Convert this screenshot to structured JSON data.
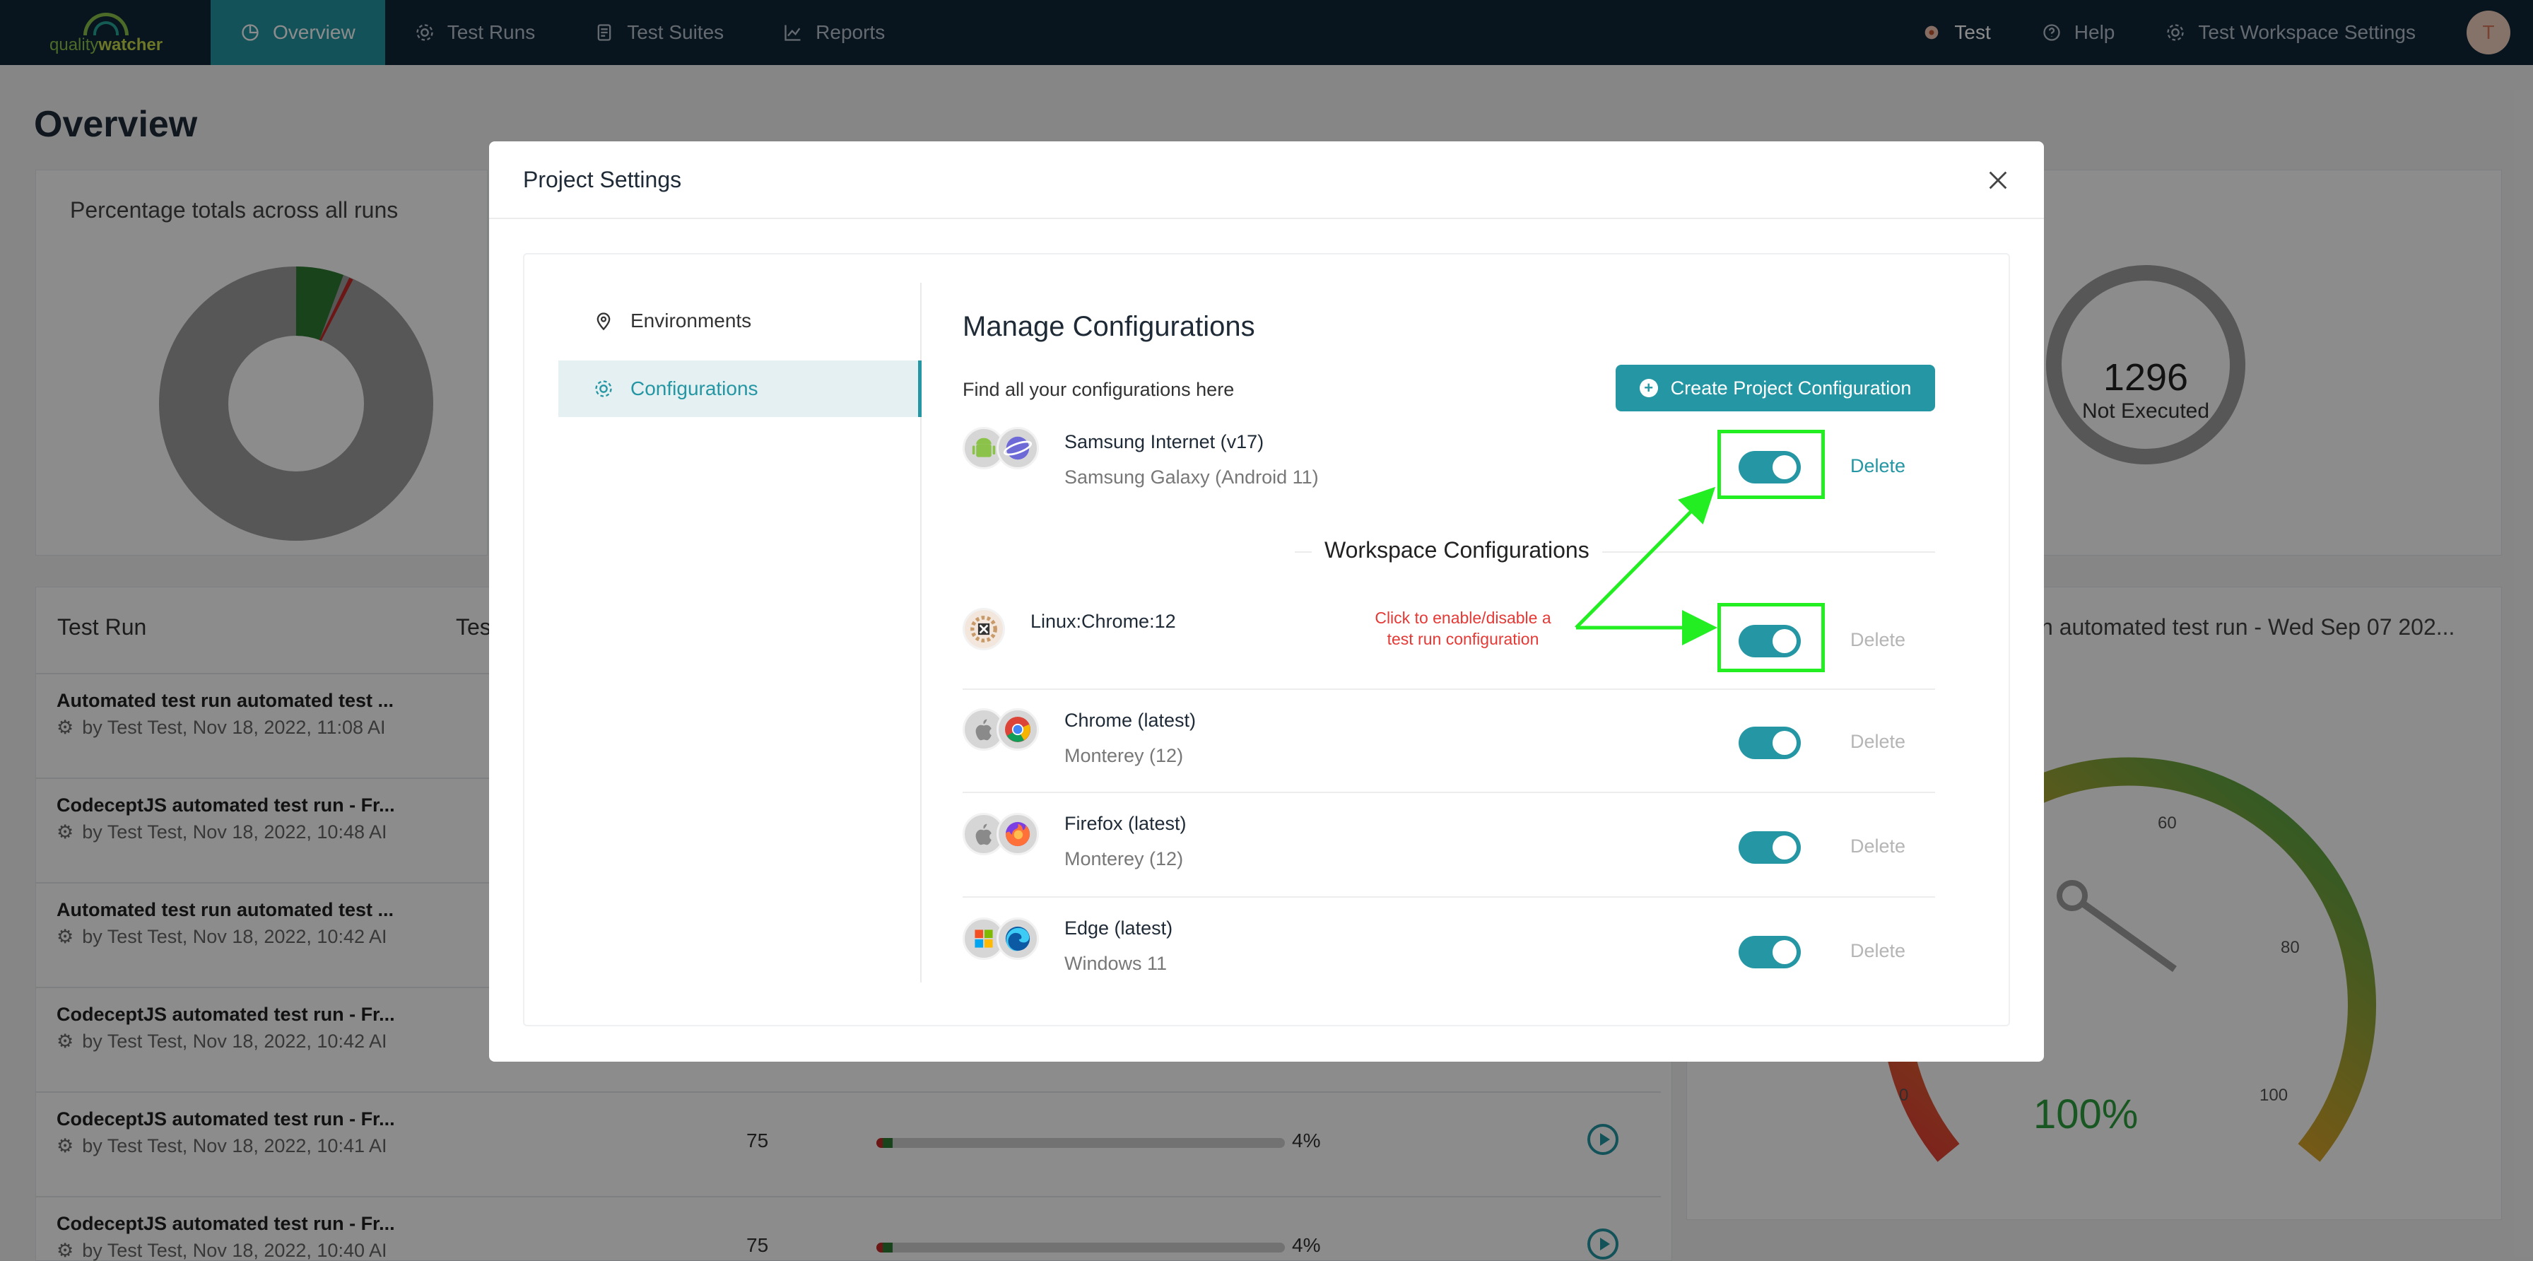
{
  "nav": {
    "logo_a": "quality",
    "logo_b": "watcher",
    "items": [
      {
        "label": "Overview",
        "active": true
      },
      {
        "label": "Test Runs"
      },
      {
        "label": "Test Suites"
      },
      {
        "label": "Reports"
      }
    ],
    "right": {
      "workspace": "Test",
      "help": "Help",
      "settings": "Test Workspace Settings",
      "avatar": "T"
    }
  },
  "page": {
    "title": "Overview",
    "card_title": "Percentage totals across all runs",
    "not_executed_count": "1296",
    "not_executed_label": "Not Executed",
    "table_col_run": "Test Run",
    "table_col_test": "Tes",
    "right_card_title": "n automated test run - Wed Sep 07 202...",
    "gauge_value": "100%",
    "gauge_ticks": [
      "0",
      "60",
      "80",
      "100"
    ],
    "runs": [
      {
        "title": "Automated test run automated test ...",
        "sub": "by Test Test, Nov 18, 2022, 11:08 AI"
      },
      {
        "title": "CodeceptJS automated test run - Fr...",
        "sub": "by Test Test, Nov 18, 2022, 10:48 AI"
      },
      {
        "title": "Automated test run automated test ...",
        "sub": "by Test Test, Nov 18, 2022, 10:42 AI"
      },
      {
        "title": "CodeceptJS automated test run - Fr...",
        "sub": "by Test Test, Nov 18, 2022, 10:42 AI"
      },
      {
        "title": "CodeceptJS automated test run - Fr...",
        "sub": "by Test Test, Nov 18, 2022, 10:41 AI",
        "count": "75",
        "pct": "4%"
      },
      {
        "title": "CodeceptJS automated test run - Fr...",
        "sub": "by Test Test, Nov 18, 2022, 10:40 AI",
        "count": "75",
        "pct": "4%"
      }
    ]
  },
  "modal": {
    "title": "Project Settings",
    "sidebar": [
      {
        "label": "Environments",
        "icon": "location-pin-icon"
      },
      {
        "label": "Configurations",
        "icon": "gear-icon",
        "active": true
      }
    ],
    "heading": "Manage Configurations",
    "subheading": "Find all your configurations here",
    "create_button": "Create Project Configuration",
    "workspace_heading": "Workspace Configurations",
    "delete_label": "Delete",
    "annotation": "Click to enable/disable a test run configuration",
    "project_configs": [
      {
        "name": "Samsung Internet (v17)",
        "device": "Samsung Galaxy (Android 11)",
        "enabled": true
      }
    ],
    "workspace_configs": [
      {
        "name": "Linux:Chrome:12",
        "device": "",
        "enabled": true
      },
      {
        "name": "Chrome (latest)",
        "device": "Monterey (12)",
        "enabled": true
      },
      {
        "name": "Firefox (latest)",
        "device": "Monterey (12)",
        "enabled": true
      },
      {
        "name": "Edge (latest)",
        "device": "Windows 11",
        "enabled": true
      }
    ]
  },
  "colors": {
    "accent": "#2596a3",
    "nav_bg": "#0f2638",
    "highlight": "#22ee22",
    "annotation": "#e53935"
  }
}
